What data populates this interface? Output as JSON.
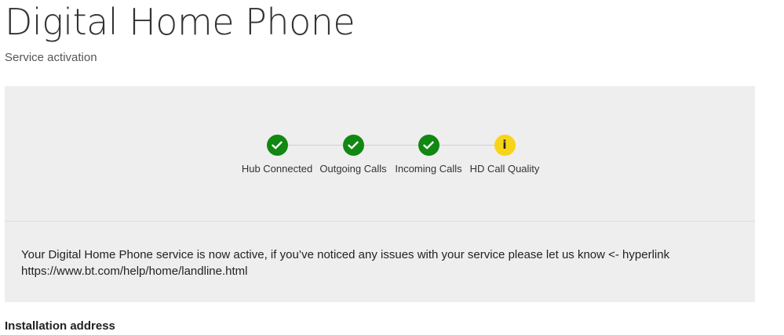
{
  "header": {
    "title": "Digital Home Phone",
    "subtitle": "Service activation"
  },
  "status": {
    "steps": [
      {
        "label": "Hub Connected",
        "state": "complete",
        "icon": "check-icon",
        "color": "#118811"
      },
      {
        "label": "Outgoing Calls",
        "state": "complete",
        "icon": "check-icon",
        "color": "#118811"
      },
      {
        "label": "Incoming Calls",
        "state": "complete",
        "icon": "check-icon",
        "color": "#118811"
      },
      {
        "label": "HD Call Quality",
        "state": "info",
        "icon": "info-icon",
        "color": "#f7d417",
        "glyph": "i"
      }
    ],
    "message": "Your Digital Home Phone service is now active, if you’ve noticed any issues with your service please let us know <- hyperlink https://www.bt.com/help/home/landline.html"
  },
  "installation": {
    "heading": "Installation address"
  }
}
